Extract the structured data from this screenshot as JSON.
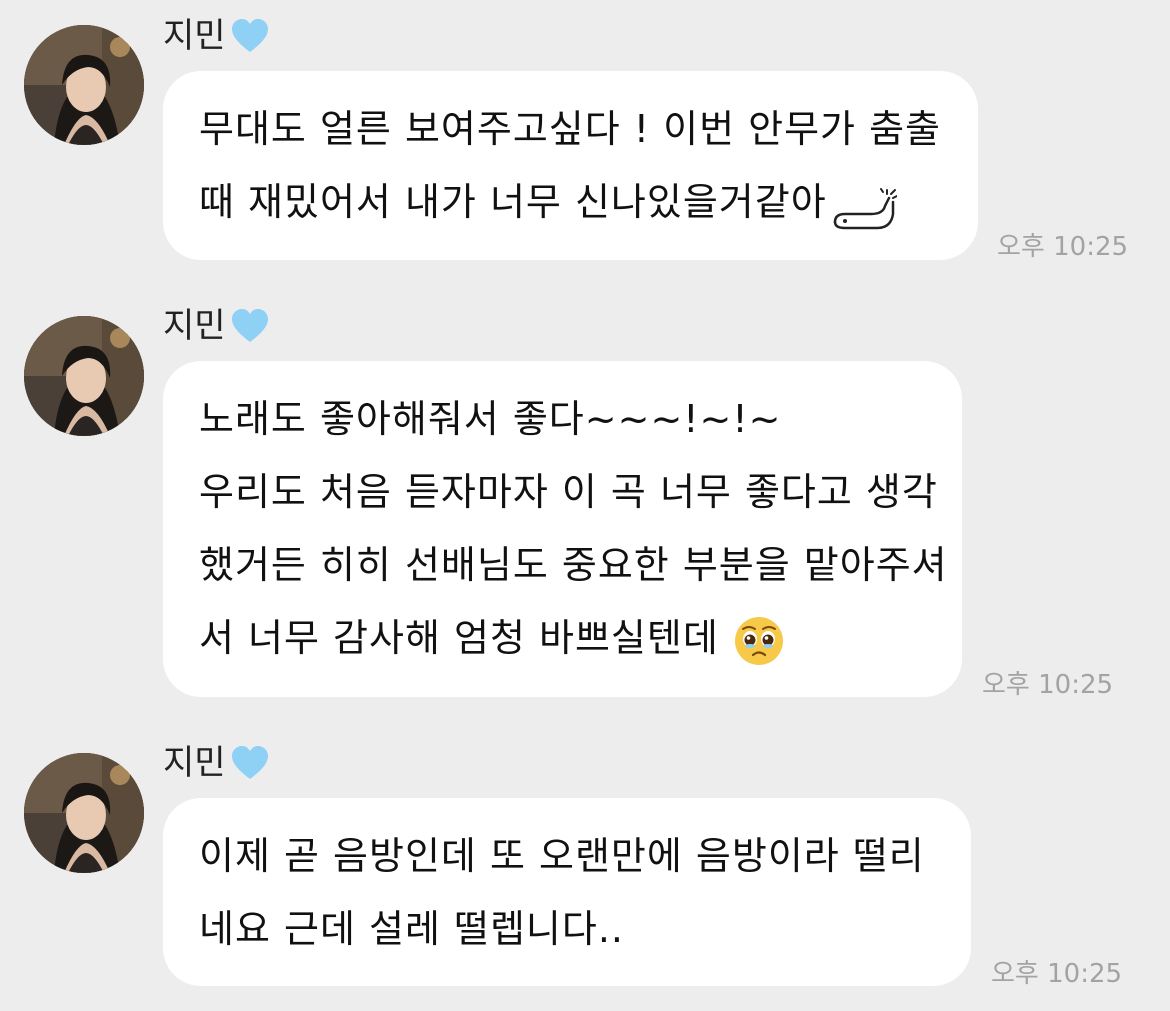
{
  "messages": [
    {
      "sender": "지민",
      "heart_icon": "light-blue-heart-icon",
      "lines": [
        "무대도 얼른 보여주고싶다 ! 이번 안무가 춤출",
        "때 재밌어서 내가 너무 신나있을거같아"
      ],
      "inline_icon": "worm-doodle-sticker-icon",
      "time": "오후 10:25"
    },
    {
      "sender": "지민",
      "heart_icon": "light-blue-heart-icon",
      "lines": [
        "노래도 좋아해줘서 좋다~~~!~!~",
        "우리도 처음 듣자마자 이 곡 너무 좋다고 생각",
        "했거든 히히 선배님도 중요한 부분을 맡아주셔",
        "서 너무 감사해 엄청 바쁘실텐데"
      ],
      "inline_icon": "pleading-face-emoji-icon",
      "time": "오후 10:25"
    },
    {
      "sender": "지민",
      "heart_icon": "light-blue-heart-icon",
      "lines": [
        "이제 곧 음방인데 또 오랜만에 음방이라 떨리",
        "네요 근데 설레 떨렙니다.."
      ],
      "time": "오후 10:25"
    }
  ],
  "colors": {
    "background": "#ededed",
    "bubble": "#ffffff",
    "heart": "#8fd0f5",
    "timestamp": "#a3a3a3"
  }
}
